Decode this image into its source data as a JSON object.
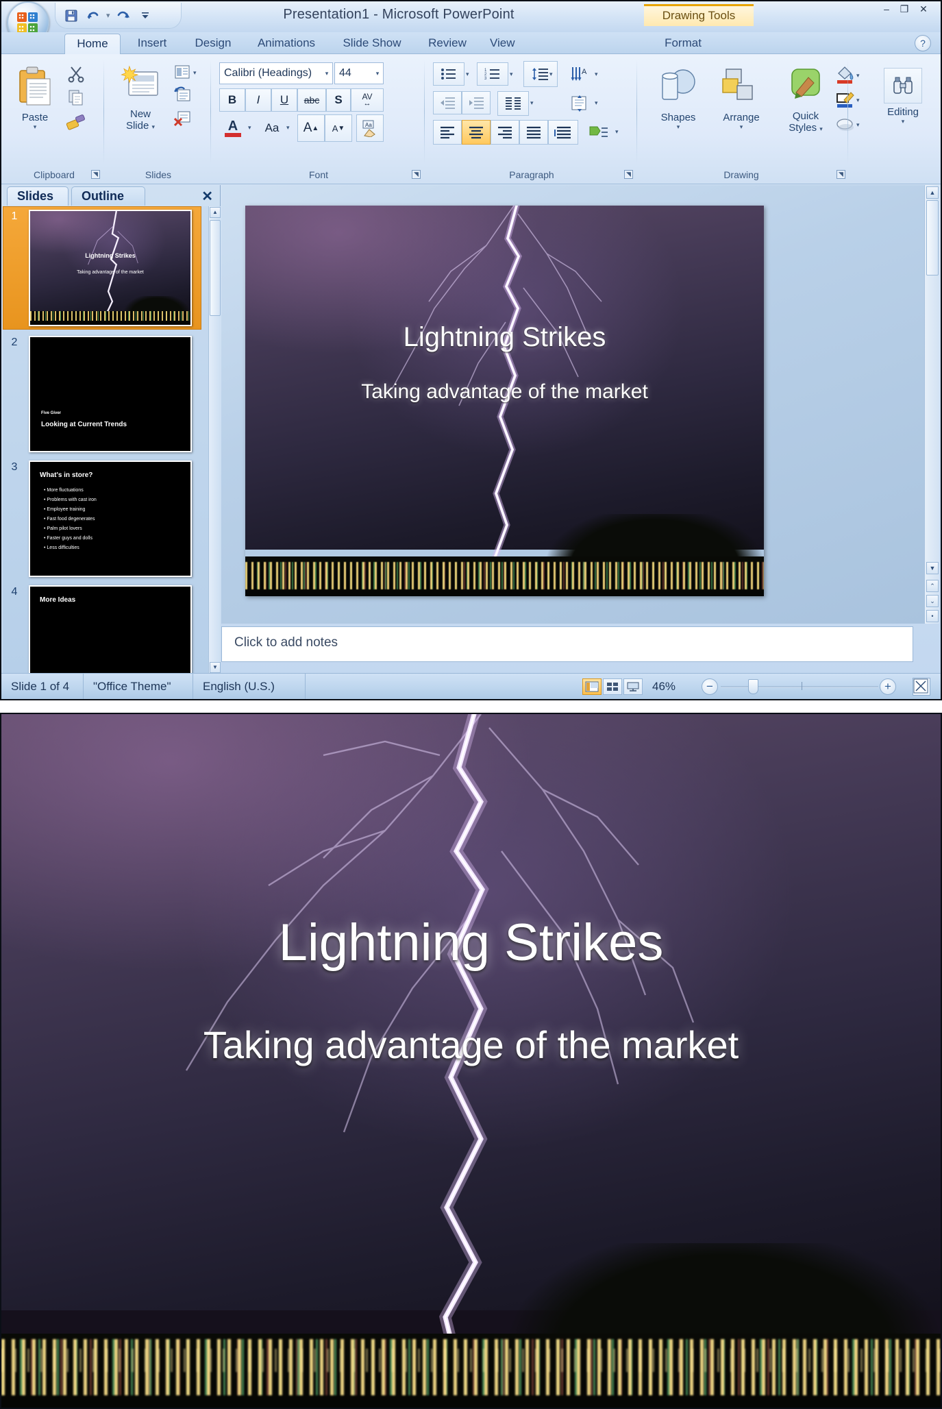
{
  "window": {
    "title": "Presentation1  -  Microsoft PowerPoint",
    "contextual_tab": "Drawing Tools",
    "minimize": "–",
    "restore": "❐",
    "close": "✕"
  },
  "quick_access": {
    "save": "save-icon",
    "undo": "undo-icon",
    "undo_caret": "▾",
    "redo": "redo-icon",
    "customize": "▾"
  },
  "ribbon": {
    "tabs": [
      {
        "label": "Home",
        "active": true
      },
      {
        "label": "Insert",
        "active": false
      },
      {
        "label": "Design",
        "active": false
      },
      {
        "label": "Animations",
        "active": false
      },
      {
        "label": "Slide Show",
        "active": false
      },
      {
        "label": "Review",
        "active": false
      },
      {
        "label": "View",
        "active": false
      },
      {
        "label": "Format",
        "active": false
      }
    ],
    "help": "?",
    "groups": [
      {
        "label": "Clipboard"
      },
      {
        "label": "Slides"
      },
      {
        "label": "Font"
      },
      {
        "label": "Paragraph"
      },
      {
        "label": "Drawing"
      }
    ],
    "clipboard": {
      "paste": "Paste",
      "paste_caret": "▾",
      "cut": "cut-icon",
      "copy": "copy-icon",
      "format_painter": "format-painter-icon"
    },
    "slides": {
      "new_slide_line1": "New",
      "new_slide_line2": "Slide",
      "new_slide_caret": "▾",
      "layout": "layout-icon",
      "layout_caret": "▾",
      "reset": "reset-icon",
      "delete": "delete-slide-icon"
    },
    "font": {
      "font_name": "Calibri (Headings)",
      "font_size": "44",
      "caret": "▾",
      "bold": "B",
      "italic": "I",
      "underline": "U",
      "strikethrough": "abc",
      "shadow": "S",
      "char_spacing": "AV",
      "font_color": "A",
      "font_color_swatch": "#d32f2f",
      "change_case": "Aa",
      "grow_font": "A",
      "shrink_font": "A",
      "clear_formatting": "clear-formatting-icon"
    },
    "paragraph": {
      "bullets": "bullets-icon",
      "numbering": "numbering-icon",
      "line_spacing": "line-spacing-icon",
      "text_direction": "text-direction-icon",
      "decrease_indent": "decrease-indent-icon",
      "increase_indent": "increase-indent-icon",
      "columns": "columns-icon",
      "align_text": "align-text-icon",
      "align_left": "align-left-icon",
      "align_center": "align-center-icon",
      "align_right": "align-right-icon",
      "justify": "justify-icon",
      "distributed": "distributed-icon",
      "convert_smartart": "smartart-icon",
      "active_alignment": "align_center"
    },
    "drawing": {
      "shapes": "Shapes",
      "arrange": "Arrange",
      "quick_styles_line1": "Quick",
      "quick_styles_line2": "Styles",
      "caret": "▾",
      "shape_fill": "shape-fill-icon",
      "shape_fill_swatch": "#d83a26",
      "shape_outline": "shape-outline-icon",
      "shape_outline_swatch": "#2a5fc0",
      "shape_effects": "shape-effects-icon"
    },
    "editing": {
      "label": "Editing",
      "caret": "▾",
      "icon": "find-binoculars-icon"
    }
  },
  "left_panel": {
    "tabs": [
      {
        "label": "Slides",
        "active": true
      },
      {
        "label": "Outline",
        "active": false
      }
    ],
    "close": "✕",
    "slides": [
      {
        "number": "1",
        "selected": true,
        "type": "title",
        "title": "Lightning Strikes",
        "subtitle": "Taking advantage of the market"
      },
      {
        "number": "2",
        "selected": false,
        "type": "section",
        "eyebrow": "Five Giver",
        "title": "Looking at Current Trends"
      },
      {
        "number": "3",
        "selected": false,
        "type": "bullets",
        "title": "What's in store?",
        "bullets": [
          "More fluctuations",
          "Problems with cast iron",
          "Employee training",
          "Fast food degenerates",
          "Palm pilot lovers",
          "Faster guys and dolls",
          "Less difficulties"
        ]
      },
      {
        "number": "4",
        "selected": false,
        "type": "bullets",
        "title": "More Ideas",
        "bullets": []
      }
    ]
  },
  "main_slide": {
    "title": "Lightning Strikes",
    "subtitle": "Taking advantage of the market"
  },
  "notes": {
    "placeholder": "Click to add notes"
  },
  "status_bar": {
    "slide_counter": "Slide 1 of 4",
    "theme": "\"Office Theme\"",
    "language": "English (U.S.)",
    "views": [
      {
        "name": "normal-view",
        "selected": true
      },
      {
        "name": "slide-sorter-view",
        "selected": false
      },
      {
        "name": "slide-show-view",
        "selected": false
      }
    ],
    "zoom_level": "46%",
    "zoom_out": "−",
    "zoom_in": "+",
    "fit_to_window": "fit-slide-icon"
  },
  "hero_slide": {
    "title": "Lightning Strikes",
    "subtitle": "Taking advantage of the market"
  },
  "colors": {
    "accent_orange": "#f0a02a",
    "ribbon_blue": "#cfe1f5",
    "title_text": "#33425c"
  }
}
